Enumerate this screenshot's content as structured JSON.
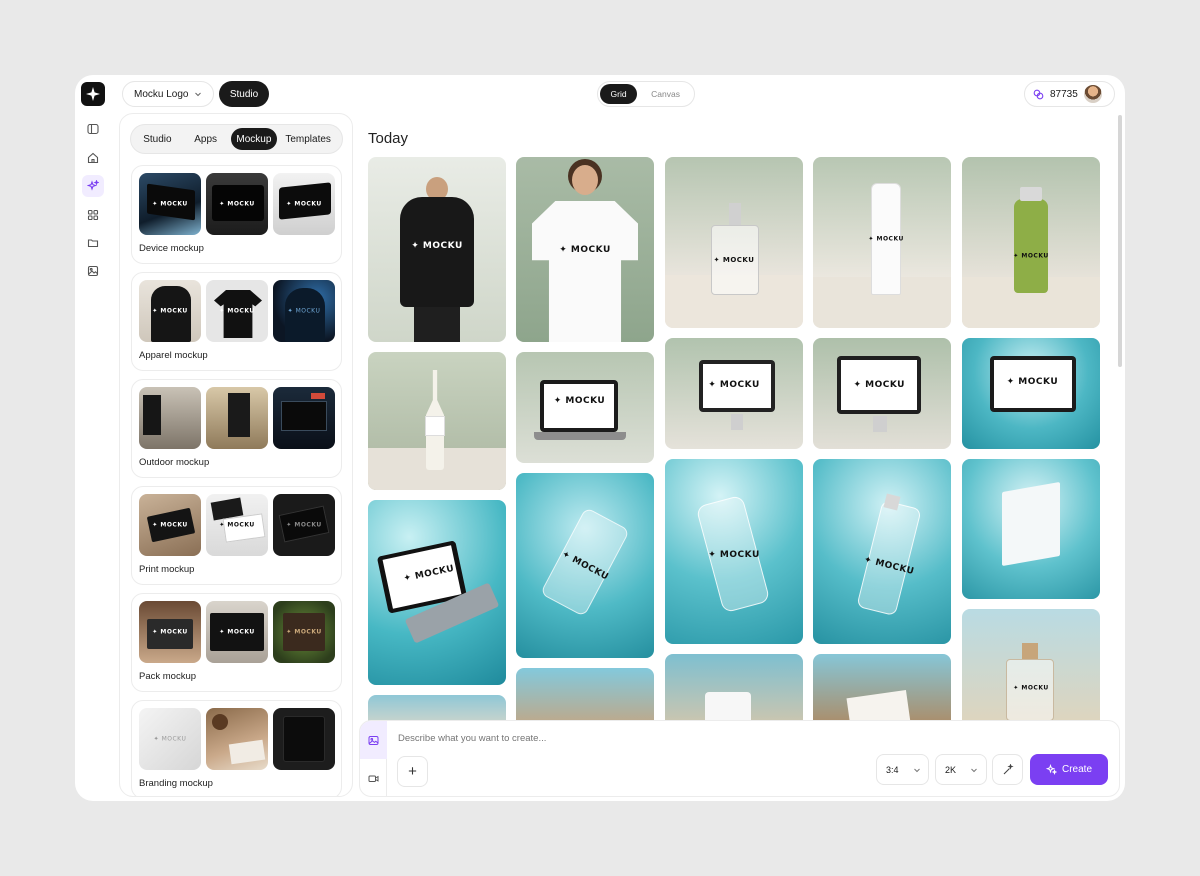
{
  "topbar": {
    "project_label": "Mocku Logo",
    "studio_label": "Studio",
    "view_grid": "Grid",
    "view_canvas": "Canvas",
    "credits": "87735"
  },
  "panel": {
    "tabs": [
      "Studio",
      "Apps",
      "Mockup",
      "Templates"
    ],
    "active_tab": "Mockup",
    "categories": [
      {
        "label": "Device mockup"
      },
      {
        "label": "Apparel mockup"
      },
      {
        "label": "Outdoor mockup"
      },
      {
        "label": "Print mockup"
      },
      {
        "label": "Pack mockup"
      },
      {
        "label": "Branding mockup"
      }
    ]
  },
  "gallery": {
    "section_title": "Today",
    "watermark": "✦ MOCKU"
  },
  "prompt": {
    "placeholder": "Describe what you want to create...",
    "aspect": "3:4",
    "resolution": "2K",
    "create_label": "Create",
    "add_symbol": "+"
  },
  "colors": {
    "accent": "#7b3ff2",
    "dark": "#1a1a1a"
  }
}
